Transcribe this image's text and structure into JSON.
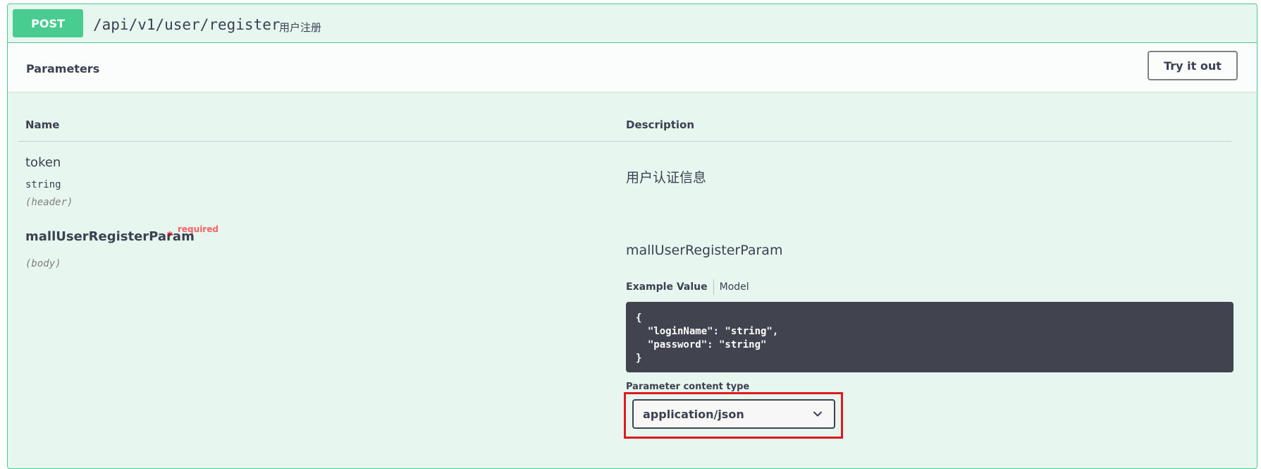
{
  "operation": {
    "method": "POST",
    "path": "/api/v1/user/register",
    "summary": "用户注册"
  },
  "parameters_section": {
    "title": "Parameters",
    "try_button": "Try it out"
  },
  "table": {
    "name_header": "Name",
    "description_header": "Description"
  },
  "params": [
    {
      "name": "token",
      "type": "string",
      "in": "(header)",
      "description": "用户认证信息"
    },
    {
      "name": "mallUserRegisterParam",
      "required_mark": "*",
      "required_label": "required",
      "in": "(body)",
      "schema_title": "mallUserRegisterParam",
      "tabs": {
        "example": "Example Value",
        "model": "Model"
      },
      "example_value": "{\n  \"loginName\": \"string\",\n  \"password\": \"string\"\n}",
      "content_type_label": "Parameter content type",
      "content_type_selected": "application/json"
    }
  ],
  "icons": {
    "select_arrow": "chevron-down-icon"
  },
  "colors": {
    "post_green": "#49cc90",
    "panel_bg": "#e8f6f0",
    "code_bg": "#41444e",
    "highlight_red": "#e0191f",
    "required_red": "#ff6060"
  }
}
